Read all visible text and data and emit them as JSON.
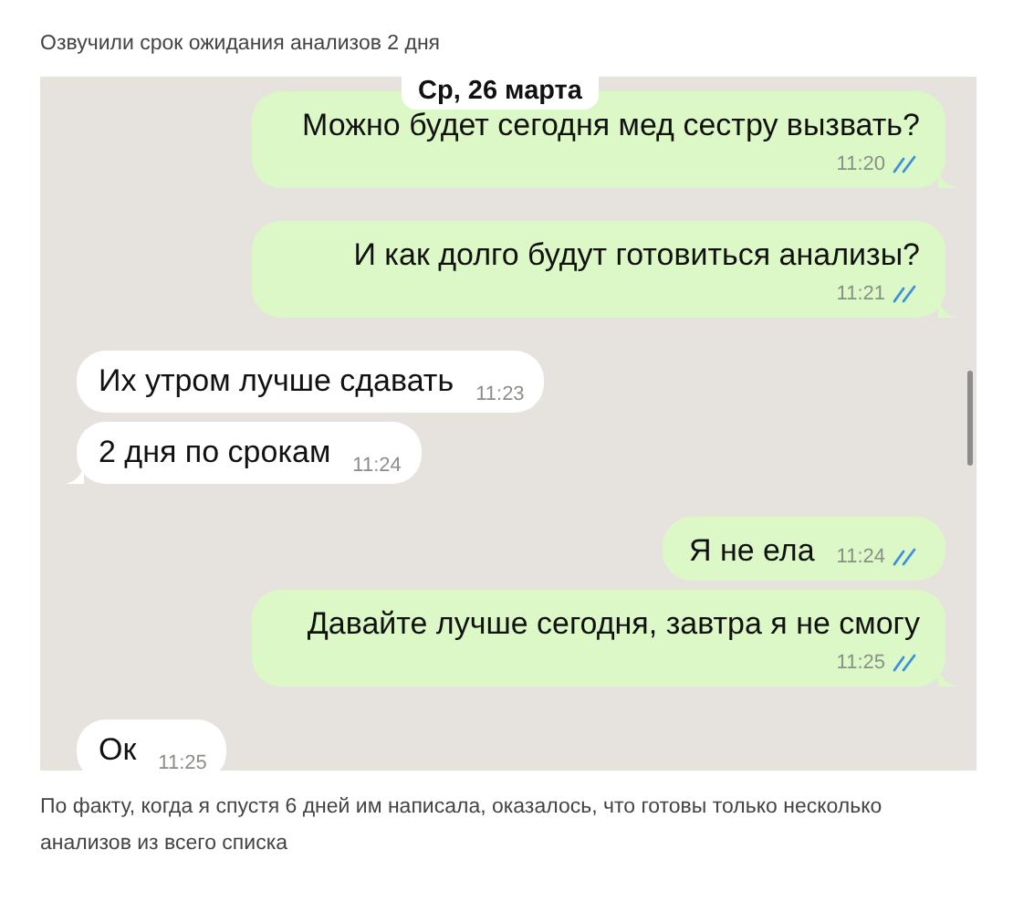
{
  "caption_top": "Озвучили срок ожидания анализов 2 дня",
  "chat": {
    "date": "Ср, 26 марта",
    "messages": [
      {
        "kind": "out",
        "text": "Можно будет сегодня мед сестру вызвать?",
        "time": "11:20",
        "read": true,
        "tail": true
      },
      {
        "kind": "out",
        "text": "И как долго будут готовиться анализы?",
        "time": "11:21",
        "read": true,
        "tail": true
      },
      {
        "kind": "in",
        "text": "Их утром лучше сдавать",
        "time": "11:23",
        "tail": false
      },
      {
        "kind": "in",
        "text": "2 дня по срокам",
        "time": "11:24",
        "tail": true
      },
      {
        "kind": "out",
        "text": "Я не ела",
        "time": "11:24",
        "read": true,
        "tail": false
      },
      {
        "kind": "out",
        "text": "Давайте лучше сегодня, завтра я не смогу",
        "time": "11:25",
        "read": true,
        "tail": true
      },
      {
        "kind": "in",
        "text": "Ок",
        "time": "11:25",
        "tail": false
      }
    ]
  },
  "caption_bottom": "По факту, когда я спустя 6 дней им написала, оказалось, что готовы только несколько анализов из всего списка"
}
